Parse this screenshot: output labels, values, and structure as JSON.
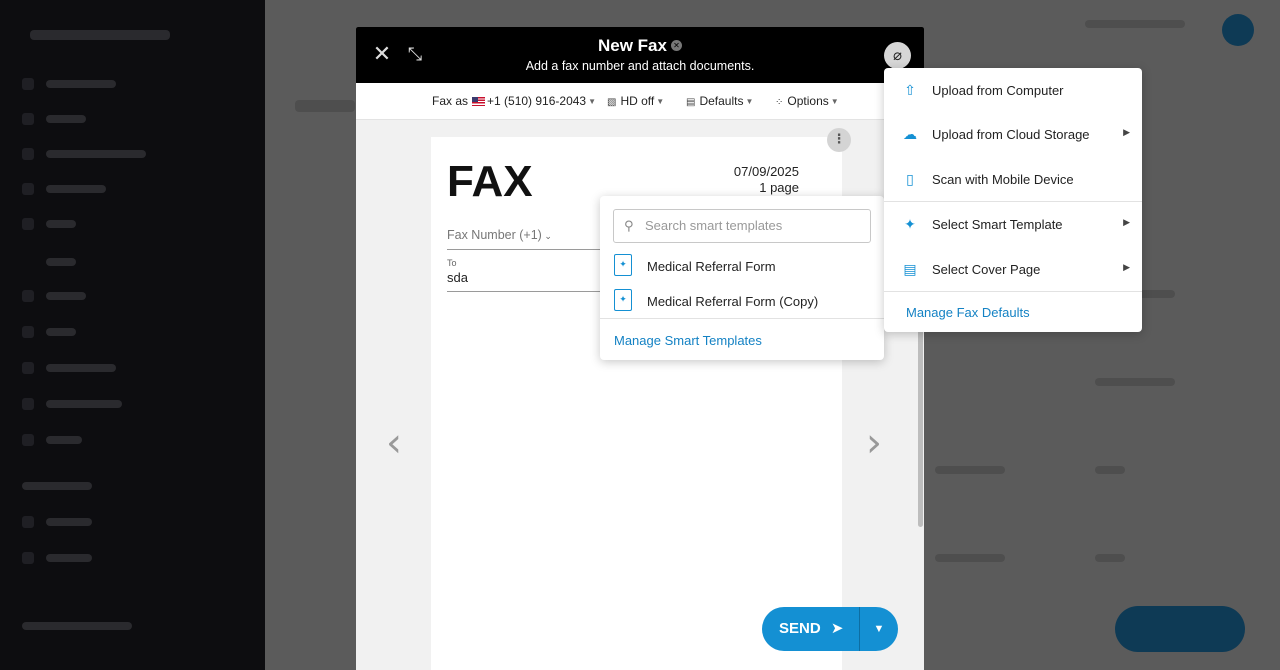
{
  "header": {
    "title": "New Fax",
    "subtitle": "Add a fax number and attach documents.",
    "close_icon": "close-icon",
    "expand_icon": "expand-icon",
    "attach_icon": "paperclip-icon"
  },
  "toolbar": {
    "fax_as_label": "Fax as",
    "fax_as_number": "+1 (510) 916-2043",
    "hd_label": "HD off",
    "defaults_label": "Defaults",
    "options_label": "Options"
  },
  "cover": {
    "title": "FAX",
    "date": "07/09/2025",
    "pages": "1 page",
    "fax_number_placeholder": "Fax Number (+1)",
    "to_label": "To",
    "to_value": "sda"
  },
  "send": {
    "label": "SEND"
  },
  "smart_templates": {
    "search_placeholder": "Search smart templates",
    "items": [
      {
        "label": "Medical Referral Form"
      },
      {
        "label": "Medical Referral Form (Copy)"
      }
    ],
    "manage_label": "Manage Smart Templates"
  },
  "attach_menu": {
    "items": [
      {
        "label": "Upload from Computer",
        "icon": "upload-file-icon"
      },
      {
        "label": "Upload from Cloud Storage",
        "icon": "cloud-upload-icon"
      },
      {
        "label": "Scan with Mobile Device",
        "icon": "mobile-icon"
      },
      {
        "label": "Select Smart Template",
        "icon": "smart-template-icon"
      },
      {
        "label": "Select Cover Page",
        "icon": "cover-page-icon"
      }
    ],
    "manage_label": "Manage Fax Defaults"
  },
  "colors": {
    "accent": "#1490d3",
    "header_bg": "#000000",
    "link": "#1482c4"
  }
}
